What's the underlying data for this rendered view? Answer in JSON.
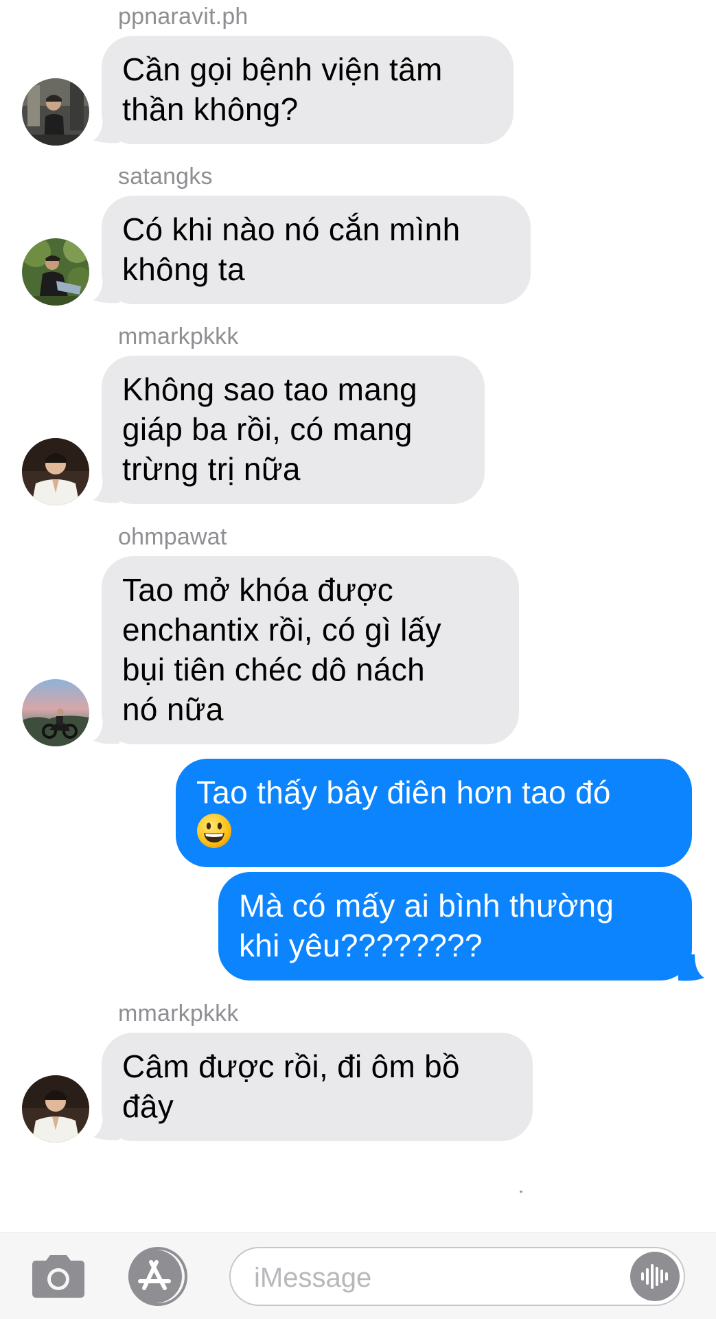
{
  "messages": [
    {
      "type": "incoming",
      "sender": "ppnaravit.ph",
      "lines": [
        "Cần gọi bệnh viện tâm",
        "thần không?"
      ]
    },
    {
      "type": "incoming",
      "sender": "satangks",
      "lines": [
        "Có khi nào nó cắn mình",
        "không ta"
      ]
    },
    {
      "type": "incoming",
      "sender": "mmarkpkkk",
      "lines": [
        "Không sao tao mang",
        "giáp ba rồi, có mang",
        "trừng trị nữa"
      ]
    },
    {
      "type": "incoming",
      "sender": "ohmpawat",
      "lines": [
        "Tao mở khóa được",
        "enchantix rồi, có gì lấy",
        "bụi tiên chéc dô nách",
        "nó nữa"
      ]
    },
    {
      "type": "outgoing",
      "lines": [
        "Tao thấy bây điên hơn tao đó"
      ],
      "emoji": "grinning-face-emoji"
    },
    {
      "type": "outgoing",
      "lines": [
        "Mà có mấy ai bình thường",
        "khi yêu????????"
      ]
    },
    {
      "type": "incoming",
      "sender": "mmarkpkkk",
      "lines": [
        "Câm được rồi, đi ôm bồ",
        "đây"
      ]
    }
  ],
  "input_bar": {
    "placeholder": "iMessage",
    "camera_icon": "camera-icon",
    "apps_icon": "app-store-icon",
    "audio_icon": "waveform-icon"
  },
  "colors": {
    "incoming_bubble": "#e9e9eb",
    "outgoing_bubble": "#0b84fe",
    "sender_name": "#8e8e93",
    "placeholder": "#b8b8bc"
  }
}
